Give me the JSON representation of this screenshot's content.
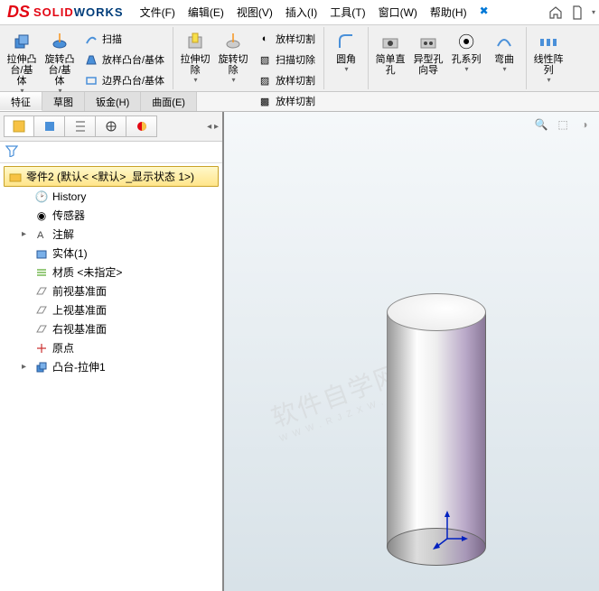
{
  "logo": {
    "text_a": "SOLID",
    "text_b": "WORKS"
  },
  "menus": [
    {
      "label": "文件(F)"
    },
    {
      "label": "编辑(E)"
    },
    {
      "label": "视图(V)"
    },
    {
      "label": "插入(I)"
    },
    {
      "label": "工具(T)"
    },
    {
      "label": "窗口(W)"
    },
    {
      "label": "帮助(H)"
    }
  ],
  "ribbon": {
    "g0": {
      "extrude": "拉伸凸台/基体",
      "revolve": "旋转凸台/基体"
    },
    "g0b": {
      "sweep": "扫描",
      "loft": "放样凸台/基体",
      "boundary": "边界凸台/基体"
    },
    "g1": {
      "cut": "拉伸切除",
      "revcut": "旋转切除"
    },
    "g1b": {
      "sweepCut": "扫描切除",
      "loftCut": "放样切割",
      "loftCut2": "放样切割",
      "loftCut3": "放样切割"
    },
    "g2": {
      "fillet": "圆角"
    },
    "g3": {
      "simpleHole": "简单直孔",
      "holeWizard": "异型孔向导",
      "holeSeries": "孔系列",
      "curve": "弯曲"
    },
    "g4": {
      "linPattern": "线性阵列"
    }
  },
  "tabs": [
    {
      "label": "特征",
      "active": true
    },
    {
      "label": "草图",
      "active": false
    },
    {
      "label": "钣金(H)",
      "active": false
    },
    {
      "label": "曲面(E)",
      "active": false
    }
  ],
  "tree": {
    "root": "零件2  (默认< <默认>_显示状态 1>)",
    "items": [
      {
        "label": "History",
        "icon": "history-icon"
      },
      {
        "label": "传感器",
        "icon": "sensor-icon"
      },
      {
        "label": "注解",
        "icon": "annotation-icon",
        "expand": "▸"
      },
      {
        "label": "实体(1)",
        "icon": "solid-icon"
      },
      {
        "label": "材质 <未指定>",
        "icon": "material-icon"
      },
      {
        "label": "前视基准面",
        "icon": "plane-icon"
      },
      {
        "label": "上视基准面",
        "icon": "plane-icon"
      },
      {
        "label": "右视基准面",
        "icon": "plane-icon"
      },
      {
        "label": "原点",
        "icon": "origin-icon"
      },
      {
        "label": "凸台-拉伸1",
        "icon": "extrude-feature-icon",
        "expand": "▸"
      }
    ]
  },
  "watermark": {
    "big": "软件自学网",
    "small": "WWW.RJZXW.COM"
  }
}
